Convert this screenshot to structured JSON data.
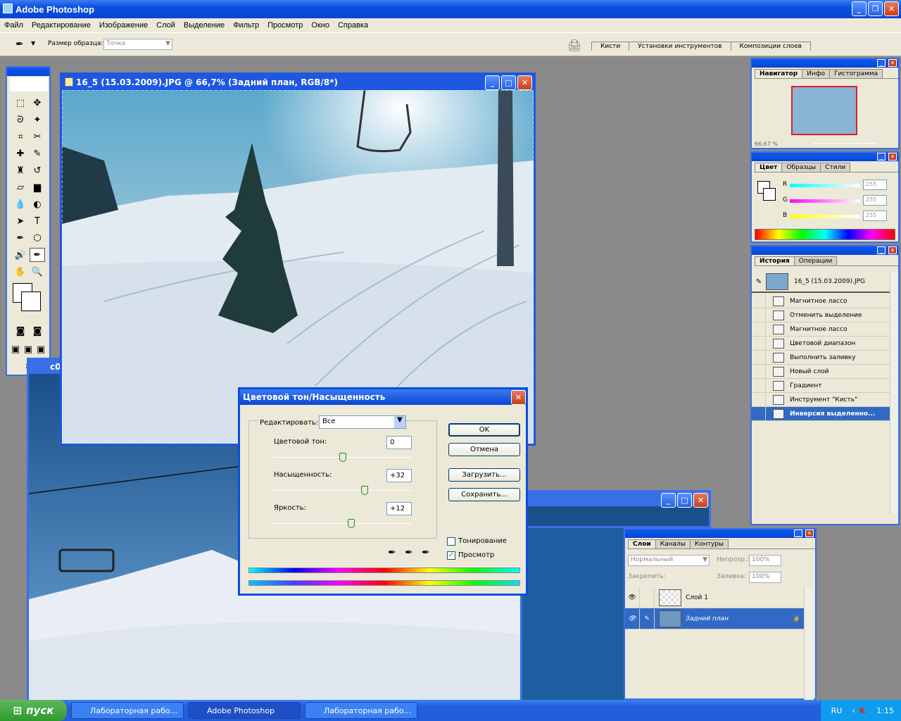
{
  "app": {
    "title": "Adobe Photoshop"
  },
  "menu": [
    "Файл",
    "Редактирование",
    "Изображение",
    "Слой",
    "Выделение",
    "Фильтр",
    "Просмотр",
    "Окно",
    "Справка"
  ],
  "options": {
    "sample_size_label": "Размер образца:",
    "sample_size_value": "Точка",
    "well_tabs": [
      "Кисти",
      "Установки инструментов",
      "Композиции слоев"
    ]
  },
  "doc1": {
    "title": "16_5 (15.03.2009).JPG @ 66,7% (Задний план, RGB/8*)"
  },
  "doc2": {
    "title_fragment": "c0"
  },
  "navigator": {
    "tabs": [
      "Навигатор",
      "Инфо",
      "Гистограмма"
    ],
    "zoom": "66,67 %"
  },
  "color": {
    "tabs": [
      "Цвет",
      "Образцы",
      "Стили"
    ],
    "r_label": "R",
    "g_label": "G",
    "b_label": "B",
    "r": "255",
    "g": "255",
    "b": "255"
  },
  "history": {
    "tabs": [
      "История",
      "Операции"
    ],
    "snapshot": "16_5 (15.03.2009).JPG",
    "items": [
      "Магнитное лассо",
      "Отменить выделение",
      "Магнитное лассо",
      "Цветовой диапазон",
      "Выполнить заливку",
      "Новый слой",
      "Градиент",
      "Инструмент \"Кисть\"",
      "Инверсия выделенно..."
    ]
  },
  "layers": {
    "tabs": [
      "Слои",
      "Каналы",
      "Контуры"
    ],
    "blend": "Нормальный",
    "opacity_label": "Непрозр.:",
    "opacity": "100%",
    "lock_label": "Закрепить:",
    "fill_label": "Заливка:",
    "fill": "100%",
    "items": [
      "Слой 1",
      "Задний план"
    ]
  },
  "dialog": {
    "title": "Цветовой тон/Насыщенность",
    "edit_label": "Редактировать:",
    "edit_value": "Все",
    "hue_label": "Цветовой тон:",
    "hue": "0",
    "hue_pos": 0.5,
    "sat_label": "Насыщенность:",
    "sat": "+32",
    "sat_pos": 0.66,
    "light_label": "Яркость:",
    "light": "+12",
    "light_pos": 0.56,
    "ok": "OK",
    "cancel": "Отмена",
    "load": "Загрузить...",
    "save": "Сохранить...",
    "colorize": "Тонирование",
    "preview": "Просмотр"
  },
  "taskbar": {
    "start": "пуск",
    "tasks": [
      "Лабораторная рабо...",
      "Adobe Photoshop",
      "Лабораторная рабо..."
    ],
    "lang": "RU",
    "time": "1:15"
  }
}
